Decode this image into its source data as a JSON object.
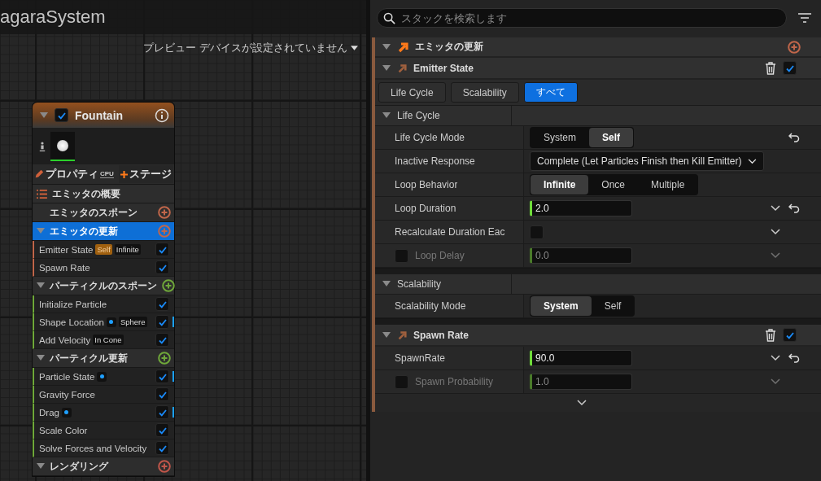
{
  "graph": {
    "title": "agaraSystem",
    "preview_device": "プレビュー デバイスが設定されていません"
  },
  "emitter_node": {
    "name": "Fountain",
    "enabled": true,
    "properties_label": "プロパティ",
    "sim_target": "CPU",
    "add_stage_label": "ステージ",
    "summary_label": "エミッタの概要",
    "groups": [
      {
        "title": "エミッタのスポーン",
        "expanded": false,
        "selected": false,
        "color": "#c0664a"
      },
      {
        "title": "エミッタの更新",
        "expanded": true,
        "selected": true,
        "color": "#c0664a",
        "modules": [
          {
            "name": "Emitter State",
            "enabled": true,
            "flagged": false,
            "tags": [
              {
                "kind": "highlight",
                "text": "Self"
              },
              {
                "kind": "plain",
                "text": "Infinite"
              }
            ]
          },
          {
            "name": "Spawn Rate",
            "enabled": true,
            "flagged": false
          }
        ]
      },
      {
        "title": "パーティクルのスポーン",
        "expanded": true,
        "selected": false,
        "color": "#6fa83a",
        "modules": [
          {
            "name": "Initialize Particle",
            "enabled": true,
            "flagged": false
          },
          {
            "name": "Shape Location",
            "enabled": true,
            "flagged": true,
            "tags": [
              {
                "kind": "dot"
              },
              {
                "kind": "plain",
                "text": "Sphere"
              }
            ]
          },
          {
            "name": "Add Velocity",
            "enabled": true,
            "flagged": false,
            "tags": [
              {
                "kind": "plain",
                "text": "In Cone"
              }
            ]
          }
        ]
      },
      {
        "title": "パーティクル更新",
        "expanded": true,
        "selected": false,
        "color": "#6fa83a",
        "modules": [
          {
            "name": "Particle State",
            "enabled": true,
            "flagged": true,
            "tags": [
              {
                "kind": "dot"
              }
            ]
          },
          {
            "name": "Gravity Force",
            "enabled": true,
            "flagged": false
          },
          {
            "name": "Drag",
            "enabled": true,
            "flagged": true,
            "tags": [
              {
                "kind": "dot"
              }
            ]
          },
          {
            "name": "Scale Color",
            "enabled": true,
            "flagged": false
          },
          {
            "name": "Solve Forces and Velocity",
            "enabled": true,
            "flagged": false
          }
        ]
      },
      {
        "title": "レンダリング",
        "expanded": true,
        "selected": false,
        "color": "#c0564a"
      }
    ]
  },
  "search": {
    "placeholder": "スタックを検索します"
  },
  "stack": {
    "section_title": "エミッタの更新",
    "modules": [
      {
        "title": "Emitter State",
        "enabled": true,
        "filters": [
          {
            "label": "Life Cycle",
            "selected": false
          },
          {
            "label": "Scalability",
            "selected": false
          },
          {
            "label": "すべて",
            "selected": true
          }
        ],
        "categories": [
          {
            "title": "Life Cycle",
            "rows": [
              {
                "kind": "segmented",
                "label": "Life Cycle Mode",
                "resettable": true,
                "options": [
                  {
                    "label": "System",
                    "selected": false
                  },
                  {
                    "label": "Self",
                    "selected": true
                  }
                ]
              },
              {
                "kind": "dropdown",
                "label": "Inactive Response",
                "value": "Complete (Let Particles Finish then Kill Emitter)"
              },
              {
                "kind": "segmented",
                "label": "Loop Behavior",
                "resettable": false,
                "options": [
                  {
                    "label": "Infinite",
                    "selected": true
                  },
                  {
                    "label": "Once",
                    "selected": false
                  },
                  {
                    "label": "Multiple",
                    "selected": false
                  }
                ]
              },
              {
                "kind": "number",
                "label": "Loop Duration",
                "value": "2.0",
                "disabled": false,
                "resettable": true
              },
              {
                "kind": "checkbox",
                "label": "Recalculate Duration Eac",
                "checked": false
              },
              {
                "kind": "number",
                "label": "Loop Delay",
                "value": "0.0",
                "disabled": true,
                "resettable": false
              }
            ]
          },
          {
            "title": "Scalability",
            "rows": [
              {
                "kind": "segmented",
                "label": "Scalability Mode",
                "resettable": false,
                "options": [
                  {
                    "label": "System",
                    "selected": true
                  },
                  {
                    "label": "Self",
                    "selected": false
                  }
                ]
              }
            ]
          }
        ]
      },
      {
        "title": "Spawn Rate",
        "enabled": true,
        "rows": [
          {
            "kind": "number",
            "label": "SpawnRate",
            "value": "90.0",
            "disabled": false,
            "resettable": true
          },
          {
            "kind": "number",
            "label": "Spawn Probability",
            "value": "1.0",
            "disabled": true,
            "resettable": false
          }
        ]
      }
    ]
  }
}
